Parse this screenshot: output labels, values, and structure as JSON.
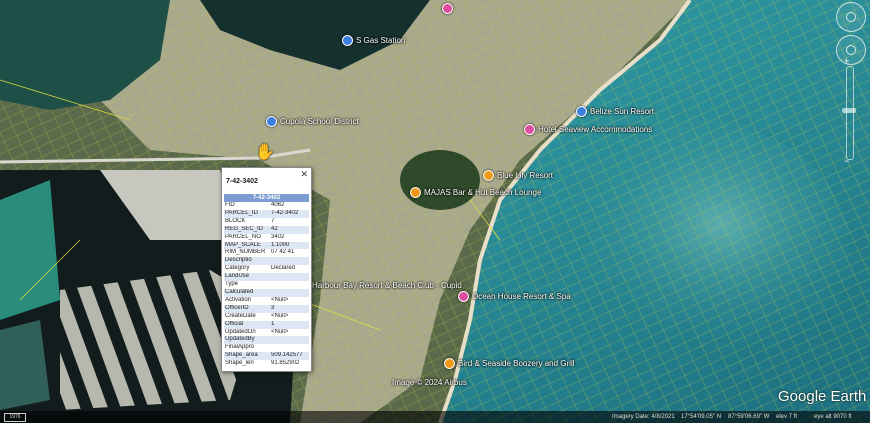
{
  "places": [
    {
      "label": "",
      "pin": "pink",
      "icon": "poi-pin-icon"
    },
    {
      "label": "S Gas Station",
      "pin": "blue",
      "icon": "gas-station-icon"
    },
    {
      "label": "Cupola School District",
      "pin": "blue",
      "icon": "school-icon"
    },
    {
      "label": "Belize Sun Resort",
      "pin": "blue",
      "icon": "poi-pin-icon"
    },
    {
      "label": "Hotel Seaview Accommodations",
      "pin": "pink",
      "icon": "hotel-icon"
    },
    {
      "label": "Blue Lily Resort",
      "pin": "orange",
      "icon": "restaurant-icon"
    },
    {
      "label": "MAJAS Bar & Hut Beach Lounge",
      "pin": "orange",
      "icon": "restaurant-icon"
    },
    {
      "label": "Harbour Bay Resort & Beach Club - Cupid",
      "pin": "",
      "icon": ""
    },
    {
      "label": "Ocean House Resort & Spa",
      "pin": "pink",
      "icon": "hotel-icon"
    },
    {
      "label": "Bird & Seaside Boozery and Grill",
      "pin": "orange",
      "icon": "restaurant-icon"
    },
    {
      "label": "Image © 2024 Airbus",
      "pin": "",
      "icon": ""
    }
  ],
  "popup": {
    "title": "7-42-3402",
    "header": "7-42-3402",
    "close_icon": "close-icon",
    "rows": [
      {
        "k": "FID",
        "v": "4062"
      },
      {
        "k": "PARCEL_ID",
        "v": "7-42-3402"
      },
      {
        "k": "BLOCK",
        "v": "7"
      },
      {
        "k": "REG_SEC_ID",
        "v": "42"
      },
      {
        "k": "PARCEL_NO",
        "v": "3402"
      },
      {
        "k": "MAP_SCALE",
        "v": "1:1000"
      },
      {
        "k": "RIM_NUMBER",
        "v": "07 42 41"
      },
      {
        "k": "Descriptio",
        "v": ""
      },
      {
        "k": "Category",
        "v": "Declared"
      },
      {
        "k": "LandUse",
        "v": ""
      },
      {
        "k": "Type",
        "v": ""
      },
      {
        "k": "Calculated",
        "v": ""
      },
      {
        "k": "Activation",
        "v": "<Null>"
      },
      {
        "k": "OfficerID",
        "v": "3"
      },
      {
        "k": "CreateDate",
        "v": "<Null>"
      },
      {
        "k": "Official",
        "v": "1"
      },
      {
        "k": "UpdatedOn",
        "v": "<Null>"
      },
      {
        "k": "UpdatedBy",
        "v": ""
      },
      {
        "k": "FinalAppro",
        "v": ""
      },
      {
        "k": "Shape_area",
        "v": "509.142577"
      },
      {
        "k": "Shape_len",
        "v": "91.852902"
      }
    ]
  },
  "logo": "Google Earth",
  "status": {
    "scale": "1976",
    "imagery_date": "Imagery Date: 4/8/2021",
    "lat": "17°54'09.05\" N",
    "lon": "87°59'06.69\" W",
    "elev": "elev    7 ft",
    "eye_alt": "eye alt   9070 ft"
  },
  "controls": {
    "zoom_in": "+",
    "zoom_out": "−"
  }
}
